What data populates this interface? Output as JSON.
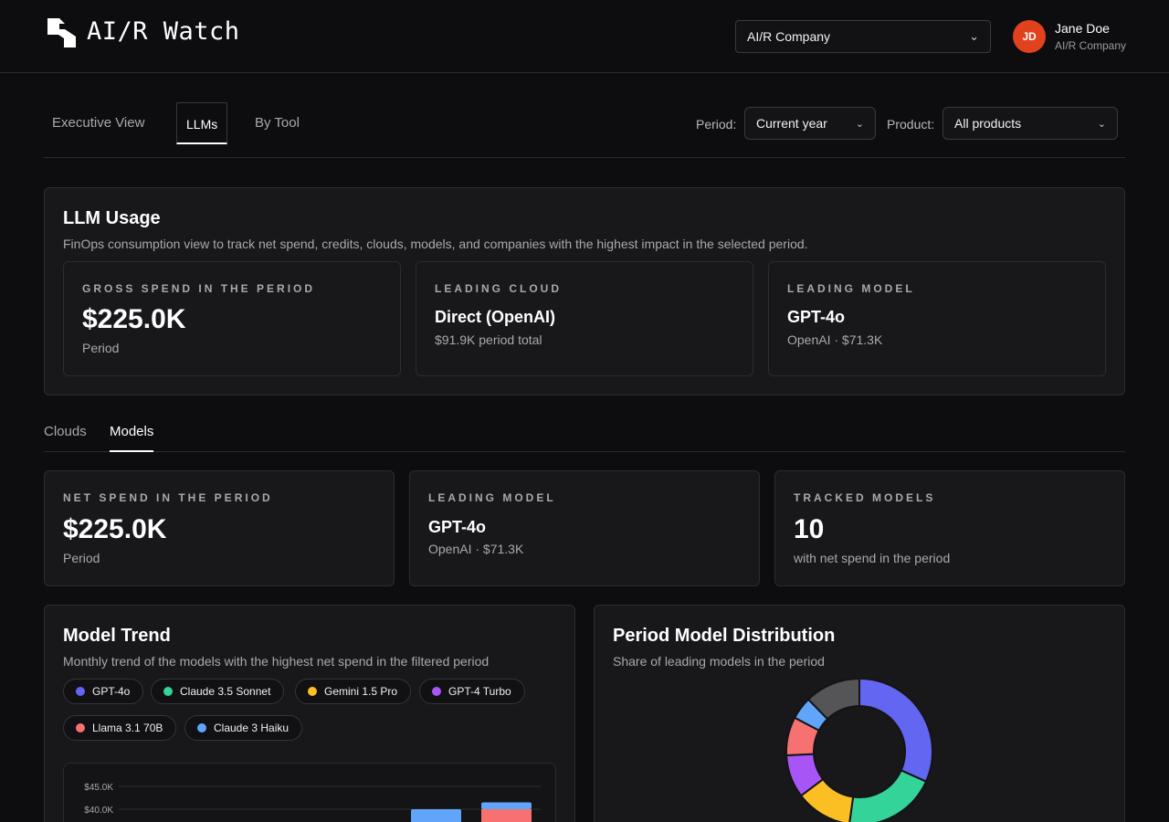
{
  "app": {
    "name": "AI/R Watch"
  },
  "header": {
    "company_select": "AI/R Company",
    "user": {
      "initials": "JD",
      "name": "Jane Doe",
      "company": "AI/R Company"
    }
  },
  "main_tabs": [
    {
      "label": "Executive View",
      "active": false
    },
    {
      "label": "LLMs",
      "active": true
    },
    {
      "label": "By Tool",
      "active": false
    }
  ],
  "filters": {
    "period": {
      "label": "Period:",
      "value": "Current year"
    },
    "product": {
      "label": "Product:",
      "value": "All products"
    }
  },
  "usage": {
    "title": "LLM Usage",
    "description": "FinOps consumption view to track net spend, credits, clouds, models, and companies with the highest impact in the selected period.",
    "kpis": [
      {
        "label": "GROSS SPEND IN THE PERIOD",
        "value": "$225.0K",
        "sub": "Period"
      },
      {
        "label": "LEADING CLOUD",
        "value": "Direct (OpenAI)",
        "sub": "$91.9K period total"
      },
      {
        "label": "LEADING MODEL",
        "value": "GPT-4o",
        "sub": "OpenAI · $71.3K"
      }
    ]
  },
  "sub_tabs": [
    {
      "label": "Clouds",
      "active": false
    },
    {
      "label": "Models",
      "active": true
    }
  ],
  "model_kpis": [
    {
      "label": "NET SPEND IN THE PERIOD",
      "value": "$225.0K",
      "sub": "Period"
    },
    {
      "label": "LEADING MODEL",
      "value": "GPT-4o",
      "sub": "OpenAI · $71.3K"
    },
    {
      "label": "TRACKED MODELS",
      "value": "10",
      "sub": "with net spend in the period"
    }
  ],
  "trend": {
    "title": "Model Trend",
    "description": "Monthly trend of the models with the highest net spend in the filtered period",
    "legend": [
      {
        "name": "GPT-4o",
        "color": "#6366f1"
      },
      {
        "name": "Claude 3.5 Sonnet",
        "color": "#34d399"
      },
      {
        "name": "Gemini 1.5 Pro",
        "color": "#fbbf24"
      },
      {
        "name": "GPT-4 Turbo",
        "color": "#a855f7"
      },
      {
        "name": "Llama 3.1 70B",
        "color": "#f87171"
      },
      {
        "name": "Claude 3 Haiku",
        "color": "#60a5fa"
      }
    ]
  },
  "distribution": {
    "title": "Period Model Distribution",
    "description": "Share of leading models in the period"
  },
  "chart_data": [
    {
      "type": "bar",
      "stacked": true,
      "title": "Model Trend",
      "yticks": [
        "$45.0K",
        "$40.0K"
      ],
      "ylim": [
        0,
        45000
      ],
      "series": [
        {
          "name": "GPT-4o",
          "color": "#6366f1",
          "values": []
        },
        {
          "name": "Claude 3.5 Sonnet",
          "color": "#34d399",
          "values": []
        },
        {
          "name": "Gemini 1.5 Pro",
          "color": "#fbbf24",
          "values": []
        },
        {
          "name": "GPT-4 Turbo",
          "color": "#a855f7",
          "values": []
        },
        {
          "name": "Llama 3.1 70B",
          "color": "#f87171",
          "values": []
        },
        {
          "name": "Claude 3 Haiku",
          "color": "#60a5fa",
          "values": []
        }
      ],
      "visible_bar_tops": [
        {
          "bar": 1,
          "total": 40000,
          "top_segment": "Claude 3 Haiku"
        },
        {
          "bar": 2,
          "total": 41500,
          "segments_visible": [
            {
              "name": "Llama 3.1 70B",
              "from": 38500,
              "to": 40000
            },
            {
              "name": "Claude 3 Haiku",
              "from": 40000,
              "to": 41500
            }
          ]
        }
      ]
    },
    {
      "type": "pie",
      "donut": true,
      "title": "Period Model Distribution",
      "slices": [
        {
          "name": "GPT-4o",
          "color": "#6366f1",
          "value": 31.7
        },
        {
          "name": "Claude 3.5 Sonnet",
          "color": "#34d399",
          "value": 20.5
        },
        {
          "name": "Gemini 1.5 Pro",
          "color": "#fbbf24",
          "value": 12.5
        },
        {
          "name": "GPT-4 Turbo",
          "color": "#a855f7",
          "value": 9.5
        },
        {
          "name": "Llama 3.1 70B",
          "color": "#f87171",
          "value": 8.5
        },
        {
          "name": "Claude 3 Haiku",
          "color": "#60a5fa",
          "value": 5.0
        },
        {
          "name": "Other",
          "color": "#555558",
          "value": 12.3
        }
      ]
    }
  ]
}
